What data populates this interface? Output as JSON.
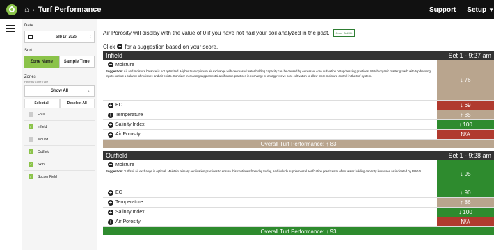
{
  "colors": {
    "green": "#8bc34a",
    "good": "#2e8b2e",
    "bad": "#b03a2e",
    "neutral": "#b9a58e",
    "overall_infield": "#b9a58e",
    "overall_outfield": "#2e8b2e"
  },
  "topbar": {
    "home_icon": "home-icon",
    "separator": "›",
    "title": "Turf Performance",
    "support": "Support",
    "setup": "Setup"
  },
  "sidebar": {
    "date_label": "Date",
    "date_value": "Sep 17, 2025",
    "sort_label": "Sort",
    "sort_zone": "Zone Name",
    "sort_time": "Sample Time",
    "zones_label": "Zones",
    "filter_label": "Filter by Zone Type",
    "show_all": "Show All",
    "select_all": "Select all",
    "deselect_all": "Deselect All",
    "zones": [
      {
        "name": "Foul",
        "checked": false
      },
      {
        "name": "Infield",
        "checked": true
      },
      {
        "name": "Mound",
        "checked": false
      },
      {
        "name": "Outfield",
        "checked": true
      },
      {
        "name": "Skin",
        "checked": true
      },
      {
        "name": "Soccer Field",
        "checked": true
      }
    ]
  },
  "main": {
    "notice": "Air Porosity will display with the value of 0 if you have not had your soil analyzed in the past.",
    "order_kit": "Order Soil Kit",
    "hint_pre": "Click",
    "hint_post": "for a suggestion based on your score."
  },
  "panels": [
    {
      "title": "Infield",
      "set": "Set 1 - 9:27 am",
      "moisture": {
        "label": "Moisture",
        "suggestion_label": "Suggestion:",
        "suggestion": "Air and moisture balance is not optimized. Higher than optimum air exchange with decreased water holding capacity can be caused by excessive core cultivation or topdressing practices. Match organic matter growth with topdressing inputs so that a balance of moisture and air exists. Consider increasing supplemental aerification practices in exchange of an aggressive core cultivation to allow more moisture control in the turf system.",
        "value": "↓ 76",
        "status": "neutral"
      },
      "rows": [
        {
          "label": "EC",
          "value": "↓ 69",
          "status": "bad"
        },
        {
          "label": "Temperature",
          "value": "↑ 85",
          "status": "neutral"
        },
        {
          "label": "Salinity Index",
          "value": "↑ 100",
          "status": "good"
        },
        {
          "label": "Air Porosity",
          "value": "N/A",
          "status": "bad"
        }
      ],
      "overall": "Overall Turf Performance: ↑ 83",
      "overall_status": "neutral"
    },
    {
      "title": "Outfield",
      "set": "Set 1 - 9:28 am",
      "moisture": {
        "label": "Moisture",
        "suggestion_label": "Suggestion:",
        "suggestion": "Turf/soil air exchange is optimal. Maintain primary aerification practices to ensure this continues from day to day, and include supplemental aerification practices to offset water holding capacity increases as indicated by POGO.",
        "value": "↓ 95",
        "status": "good"
      },
      "rows": [
        {
          "label": "EC",
          "value": "↓ 90",
          "status": "good"
        },
        {
          "label": "Temperature",
          "value": "↑ 86",
          "status": "neutral"
        },
        {
          "label": "Salinity Index",
          "value": "↓ 100",
          "status": "good"
        },
        {
          "label": "Air Porosity",
          "value": "N/A",
          "status": "bad"
        }
      ],
      "overall": "Overall Turf Performance: ↑ 93",
      "overall_status": "good"
    }
  ]
}
